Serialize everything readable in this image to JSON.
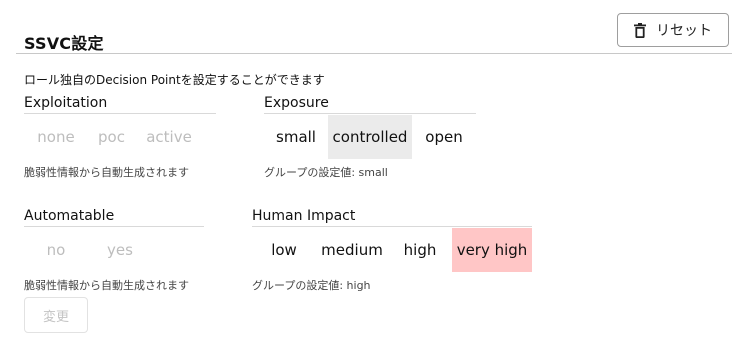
{
  "section": {
    "title": "SSVC設定",
    "description": "ロール独自のDecision Pointを設定することができます"
  },
  "reset_button": {
    "label": "リセット",
    "icon": "trash-icon"
  },
  "exploitation": {
    "label": "Exploitation",
    "options": [
      "none",
      "poc",
      "active"
    ],
    "helper": "脆弱性情報から自動生成されます"
  },
  "exposure": {
    "label": "Exposure",
    "options": [
      "small",
      "controlled",
      "open"
    ],
    "selected": "controlled",
    "helper_prefix": "グループの設定値: ",
    "helper_value": "small"
  },
  "automatable": {
    "label": "Automatable",
    "options": [
      "no",
      "yes"
    ],
    "helper": "脆弱性情報から自動生成されます"
  },
  "human_impact": {
    "label": "Human Impact",
    "options": [
      "low",
      "medium",
      "high",
      "very high"
    ],
    "selected": "very high",
    "helper_prefix": "グループの設定値: ",
    "helper_value": "high"
  },
  "change_button": {
    "label": "変更"
  },
  "colors": {
    "selected_neutral": "#ebebeb",
    "selected_critical": "#ffc6c6",
    "disabled_text": "#bdbdbd"
  }
}
